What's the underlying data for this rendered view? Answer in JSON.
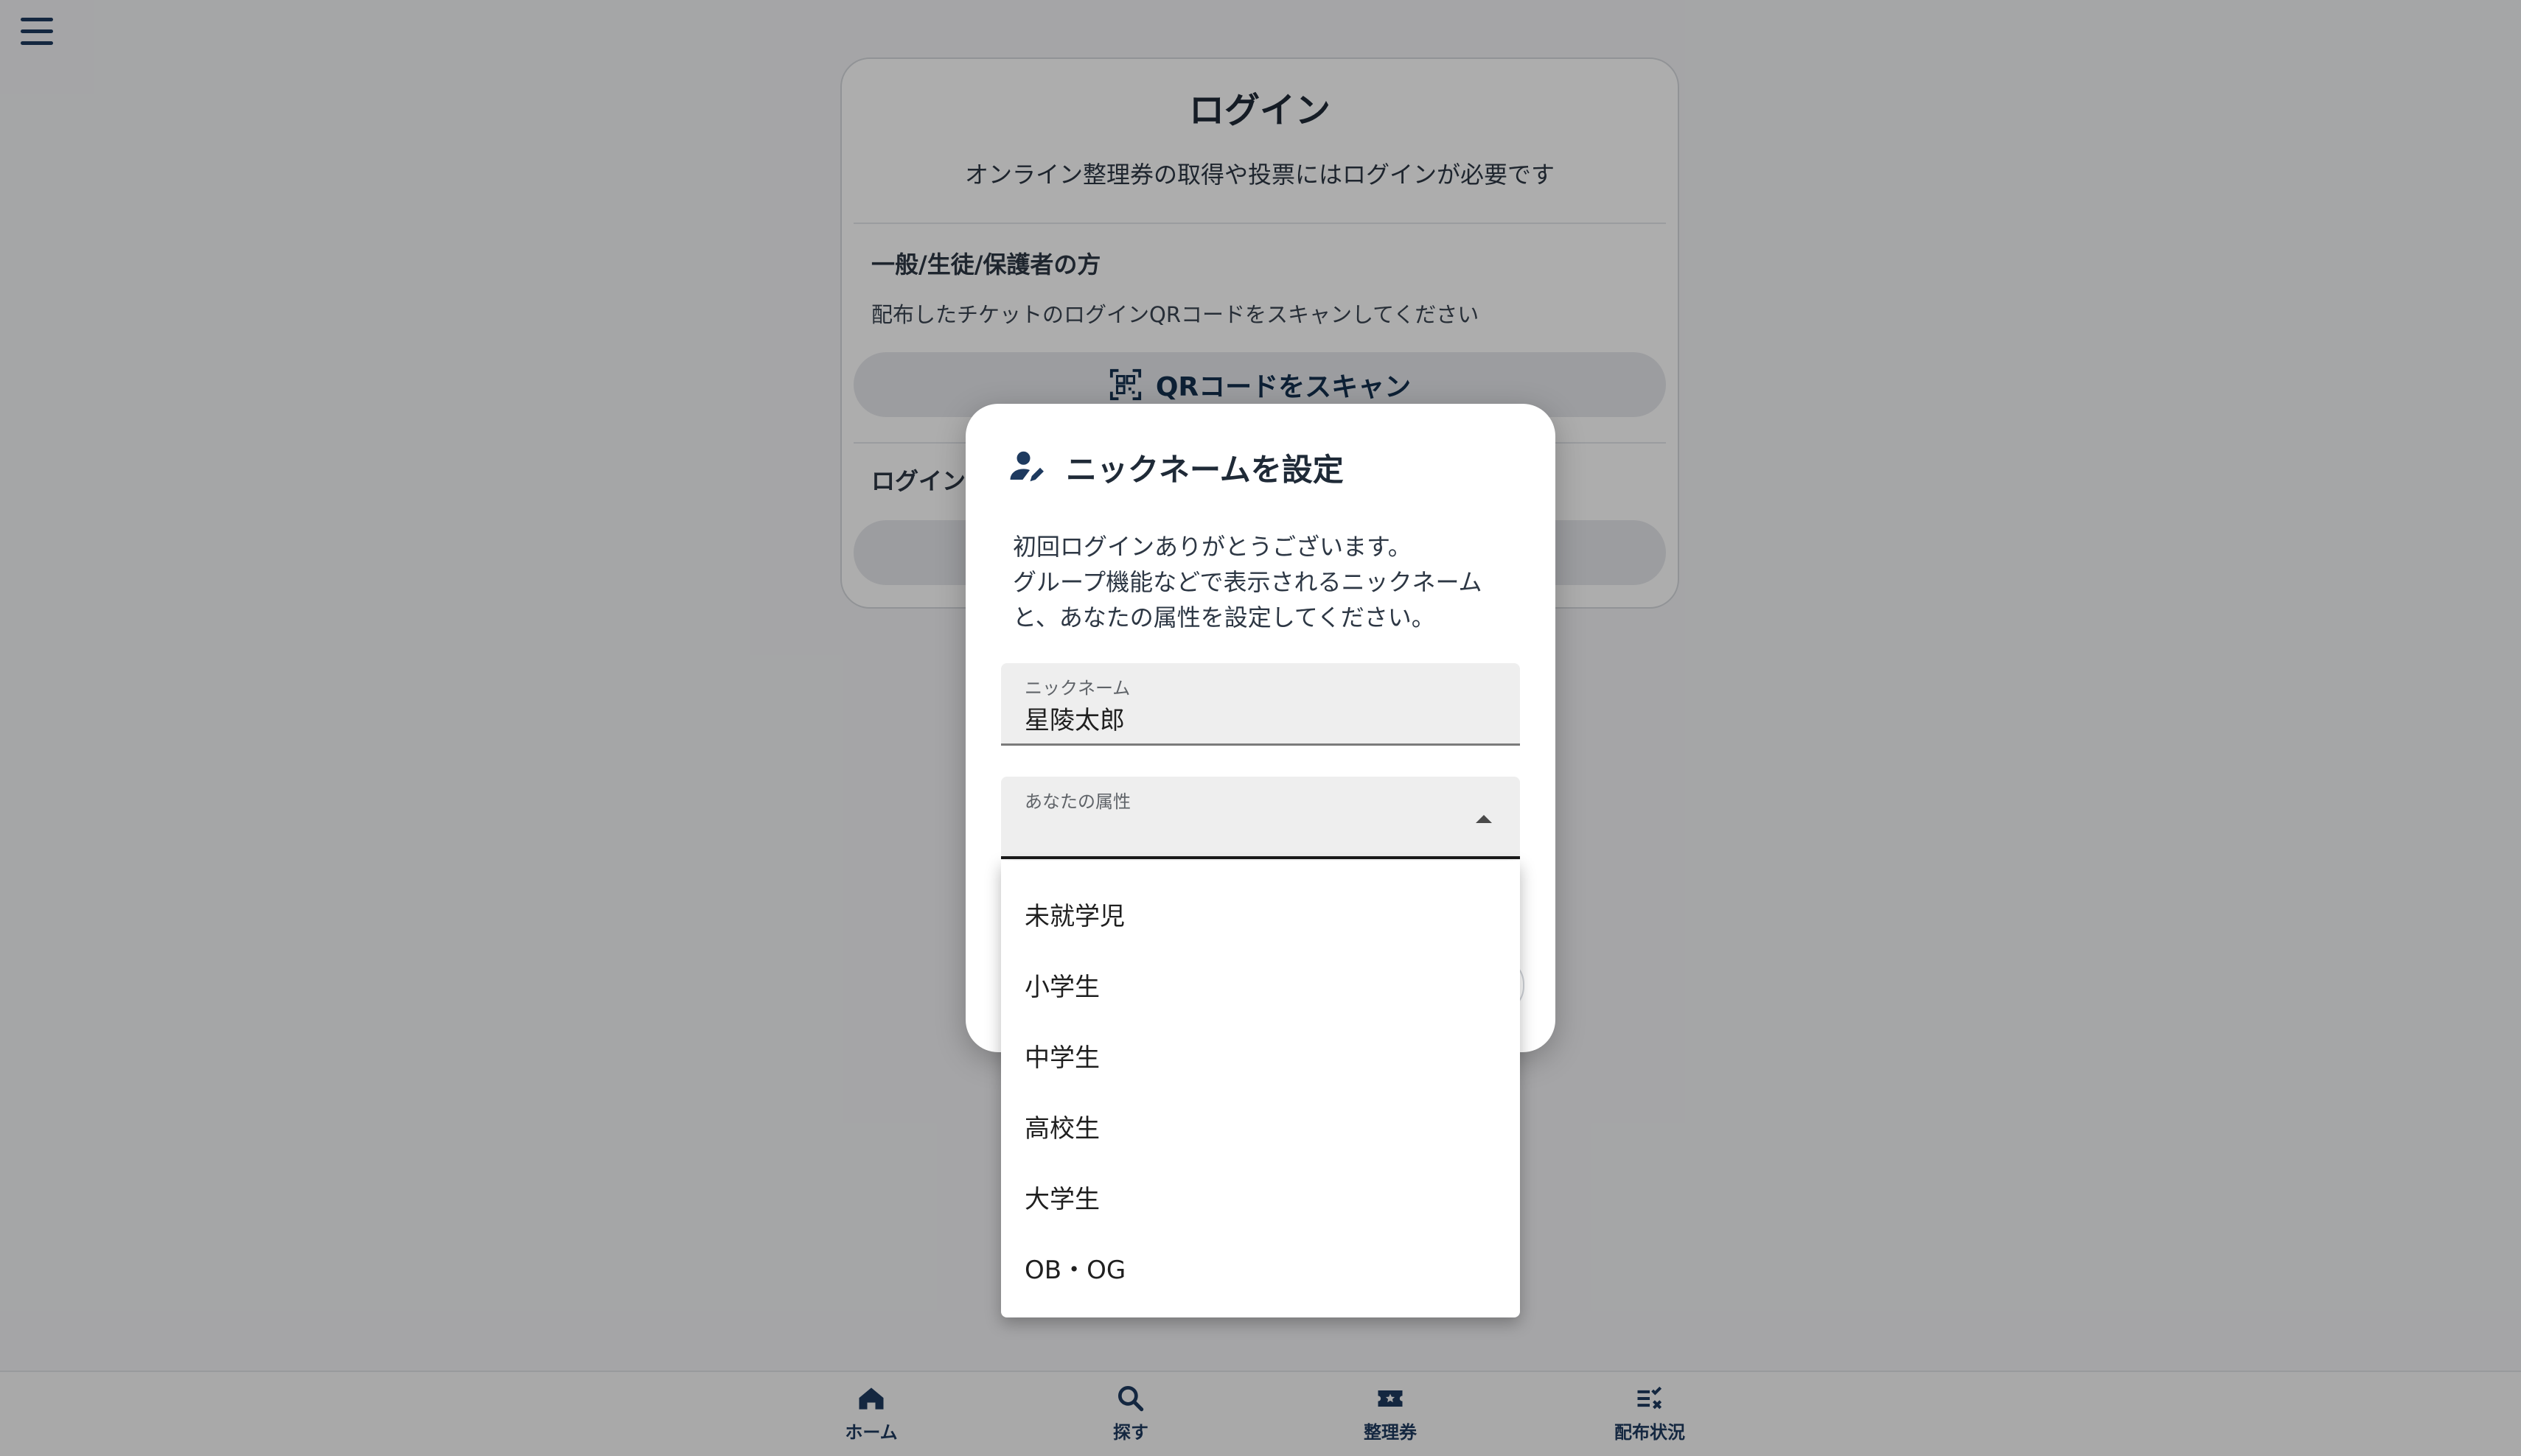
{
  "app": {
    "menu_icon": "hamburger-menu-icon"
  },
  "login": {
    "title": "ログイン",
    "subtitle": "オンライン整理券の取得や投票にはログインが必要です",
    "general_section": {
      "heading": "一般/生徒/保護者の方",
      "description": "配布したチケットのログインQRコードをスキャンしてください",
      "button_label": "QRコードをスキャン",
      "button_icon": "qr-scan-icon"
    },
    "second_section": {
      "heading": "ログイン"
    }
  },
  "dialog": {
    "icon": "user-edit-icon",
    "title": "ニックネームを設定",
    "body_lines": [
      "初回ログインありがとうございます。",
      "グループ機能などで表示されるニックネーム",
      "と、あなたの属性を設定してください。"
    ],
    "nickname_field": {
      "label": "ニックネーム",
      "value": "星陵太郎"
    },
    "attribute_field": {
      "label": "あなたの属性",
      "value": ""
    }
  },
  "attribute_menu": {
    "options": [
      "未就学児",
      "小学生",
      "中学生",
      "高校生",
      "大学生",
      "OB・OG"
    ]
  },
  "bottom_nav": {
    "items": [
      {
        "label": "ホーム",
        "icon": "home-icon"
      },
      {
        "label": "探す",
        "icon": "search-icon"
      },
      {
        "label": "整理券",
        "icon": "ticket-icon"
      },
      {
        "label": "配布状況",
        "icon": "checklist-icon"
      }
    ]
  },
  "colors": {
    "accent": "#1e3a5f",
    "scrim": "rgba(0,0,0,0.32)"
  }
}
